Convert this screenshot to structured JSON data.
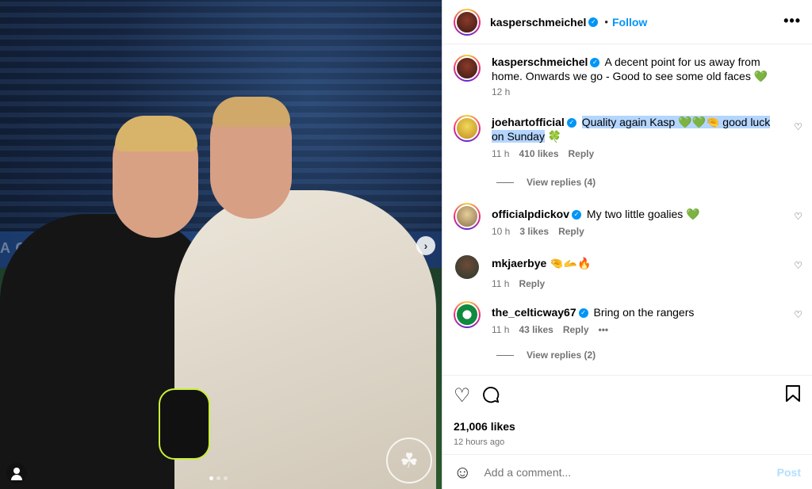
{
  "photo": {
    "banner_text": "A CHAMI",
    "next_icon": "chevron-right",
    "carousel_dots": 3,
    "carousel_active": 0
  },
  "post": {
    "author": "kasperschmeichel",
    "follow_label": "Follow",
    "more_icon": "•••",
    "caption_user": "kasperschmeichel",
    "caption_text": "A decent point for us away from home. Onwards we go - Good to see some old faces 💚",
    "caption_time": "12 h"
  },
  "comments": [
    {
      "user": "joehartofficial",
      "verified": true,
      "text_highlighted": "Quality again Kasp 💚💚🤏 good luck on Sunday",
      "text_tail": " 🍀",
      "time": "11 h",
      "likes": "410 likes",
      "reply": "Reply",
      "view_replies": "View replies (4)"
    },
    {
      "user": "officialpdickov",
      "verified": true,
      "text": "My two little goalies 💚",
      "time": "10 h",
      "likes": "3 likes",
      "reply": "Reply"
    },
    {
      "user": "mkjaerbye",
      "verified": false,
      "text": "🤏🫴🔥",
      "time": "11 h",
      "reply": "Reply"
    },
    {
      "user": "the_celticway67",
      "verified": true,
      "text": "Bring on the rangers",
      "time": "11 h",
      "likes": "43 likes",
      "reply": "Reply",
      "more": "•••",
      "view_replies": "View replies (2)"
    }
  ],
  "actions": {
    "likes": "21,006 likes",
    "time_ago": "12 hours ago"
  },
  "add_comment": {
    "placeholder": "Add a comment...",
    "post_label": "Post"
  },
  "colors": {
    "accent": "#0095f6",
    "highlight": "#b4d5fe",
    "muted": "#737373"
  }
}
